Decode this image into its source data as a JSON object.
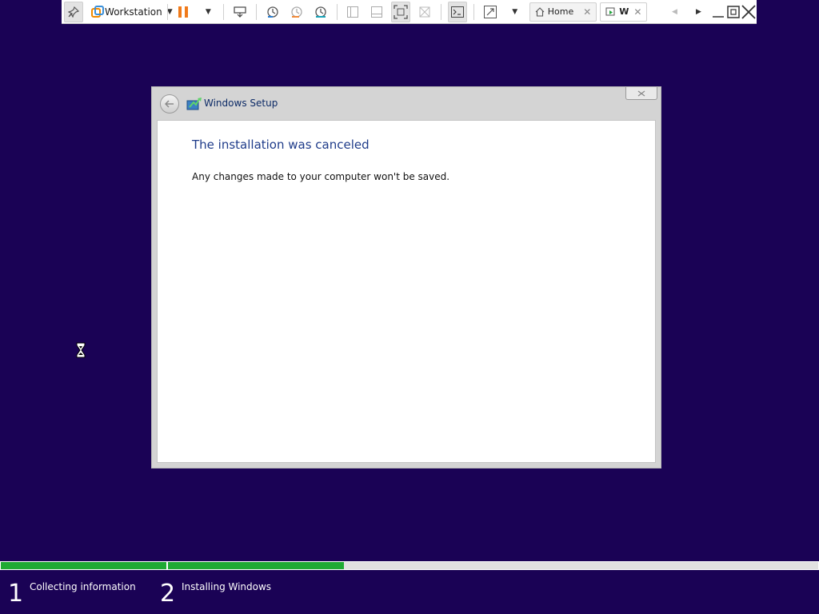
{
  "vm_toolbar": {
    "product_menu_label": "Workstation",
    "tabs": [
      {
        "label": "Home",
        "icon": "home-icon",
        "active": false
      },
      {
        "label": "W",
        "icon": "vm-icon",
        "active": true
      }
    ]
  },
  "dialog": {
    "title": "Windows Setup",
    "heading": "The installation was canceled",
    "message": "Any changes made to your computer won't be saved."
  },
  "progress": {
    "steps": [
      {
        "number": "1",
        "label": "Collecting information",
        "progress": 1.0
      },
      {
        "number": "2",
        "label": "Installing Windows",
        "progress": 0.27
      }
    ]
  },
  "colors": {
    "desktop_background": "#1a0255",
    "progress_fill": "#1faa34",
    "heading_text": "#1f3c8a"
  }
}
